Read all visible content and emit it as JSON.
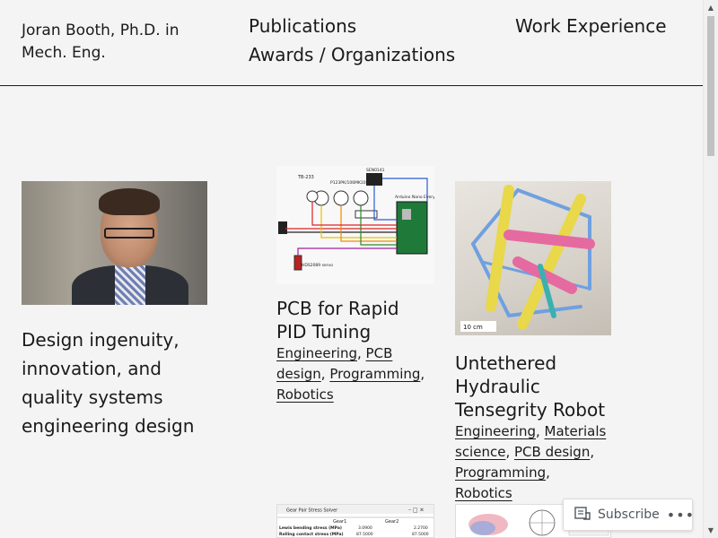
{
  "site": {
    "title": "Joran Booth, Ph.D. in Mech. Eng."
  },
  "nav": {
    "publications": "Publications",
    "awards": "Awards / Organizations",
    "work": "Work Experience"
  },
  "hero": {
    "tagline": "Design ingenuity, innovation, and quality systems engineering design"
  },
  "posts": [
    {
      "title": "PCB for Rapid PID Tuning",
      "categories": [
        "Engineering",
        "PCB design",
        "Programming",
        "Robotics"
      ]
    },
    {
      "title": "Untethered Hydraulic Tensegrity Robot",
      "categories": [
        "Engineering",
        "Materials science",
        "PCB design",
        "Programming",
        "Robotics"
      ]
    }
  ],
  "thumbs": {
    "pcb_labels": [
      "TB-233",
      "P123PK/106MK10K",
      "SEN0141",
      "Arduino Nano Every",
      "HDS2089 servo",
      "10 cm"
    ],
    "robot_scale": "10 cm",
    "gear_title": "Gear Pair Stress Solver",
    "gear_cols": [
      "Gear1",
      "Gear2"
    ],
    "gear_rows": [
      {
        "label": "Lewis bending stress (MPa)",
        "v1": "3.0900",
        "v2": "2.2700"
      },
      {
        "label": "Rolling contact stress (MPa)",
        "v1": "87.5000",
        "v2": "87.5000"
      }
    ]
  },
  "subscribe": {
    "label": "Subscribe",
    "more": "•••"
  },
  "colors": {
    "background": "#f4f4f4",
    "text": "#1a1a1a"
  }
}
